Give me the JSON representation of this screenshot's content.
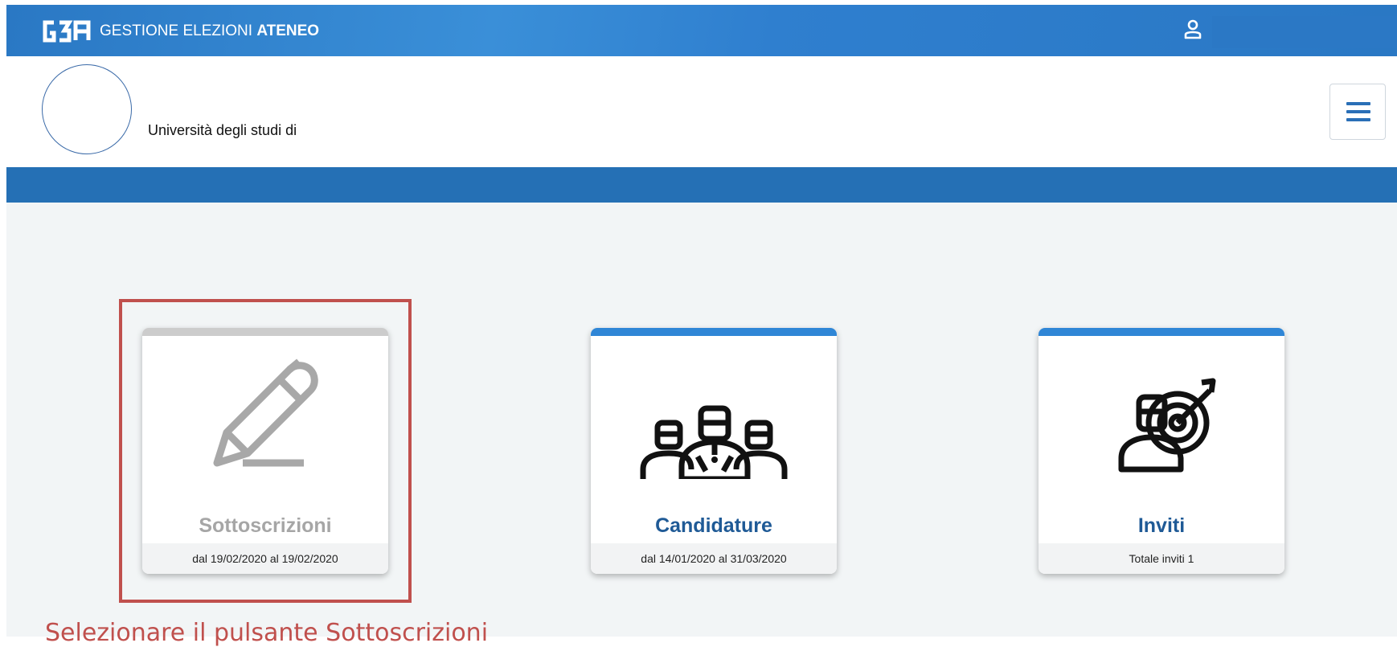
{
  "topbar": {
    "logo_text": "G3A",
    "title_regular": "GESTIONE ELEZIONI ",
    "title_bold": "ATENEO",
    "user_icon": "user-icon"
  },
  "header": {
    "university_name": "Università degli studi di",
    "menu_icon": "hamburger-menu-icon"
  },
  "cards": [
    {
      "title": "Sottoscrizioni",
      "subtitle": "dal 19/02/2020 al 19/02/2020",
      "icon": "pencil-icon",
      "accent": "#cccccc",
      "title_color": "#a6a6a6",
      "state": "disabled"
    },
    {
      "title": "Candidature",
      "subtitle": "dal 14/01/2020 al 31/03/2020",
      "icon": "candidates-group-icon",
      "accent": "#2f86d6",
      "title_color": "#1f5a96"
    },
    {
      "title": "Inviti",
      "subtitle": "Totale inviti 1",
      "icon": "target-person-icon",
      "accent": "#2f86d6",
      "title_color": "#1f5a96"
    }
  ],
  "annotation": {
    "text": "Selezionare il pulsante Sottoscrizioni",
    "color": "#c0504d"
  },
  "colors": {
    "topbar": "#2a78c4",
    "stripe": "#2570b5",
    "content_bg": "#f2f5f6"
  }
}
